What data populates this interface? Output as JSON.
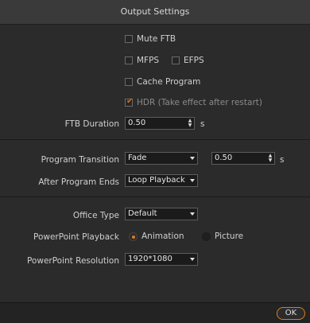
{
  "window": {
    "title": "Output Settings"
  },
  "options": {
    "mute_ftb": {
      "label": "Mute FTB",
      "checked": false
    },
    "mfps": {
      "label": "MFPS",
      "checked": false
    },
    "efps": {
      "label": "EFPS",
      "checked": false
    },
    "cache_program": {
      "label": "Cache Program",
      "checked": false
    },
    "hdr": {
      "label": "HDR (Take effect after restart)",
      "checked": true,
      "enabled": false
    }
  },
  "ftb_duration": {
    "label": "FTB Duration",
    "value": "0.50",
    "unit": "s"
  },
  "program_transition": {
    "label": "Program Transition",
    "type": "Fade",
    "duration": "0.50",
    "unit": "s"
  },
  "after_program_ends": {
    "label": "After Program Ends",
    "value": "Loop Playback"
  },
  "office_type": {
    "label": "Office Type",
    "value": "Default"
  },
  "powerpoint_playback": {
    "label": "PowerPoint Playback",
    "options": [
      "Animation",
      "Picture"
    ],
    "selected": "Animation"
  },
  "powerpoint_resolution": {
    "label": "PowerPoint Resolution",
    "value": "1920*1080"
  },
  "footer": {
    "ok_label": "OK"
  },
  "colors": {
    "accent": "#e07a1f",
    "background": "#2b2b2b",
    "titlebar": "#3a3a3a"
  }
}
